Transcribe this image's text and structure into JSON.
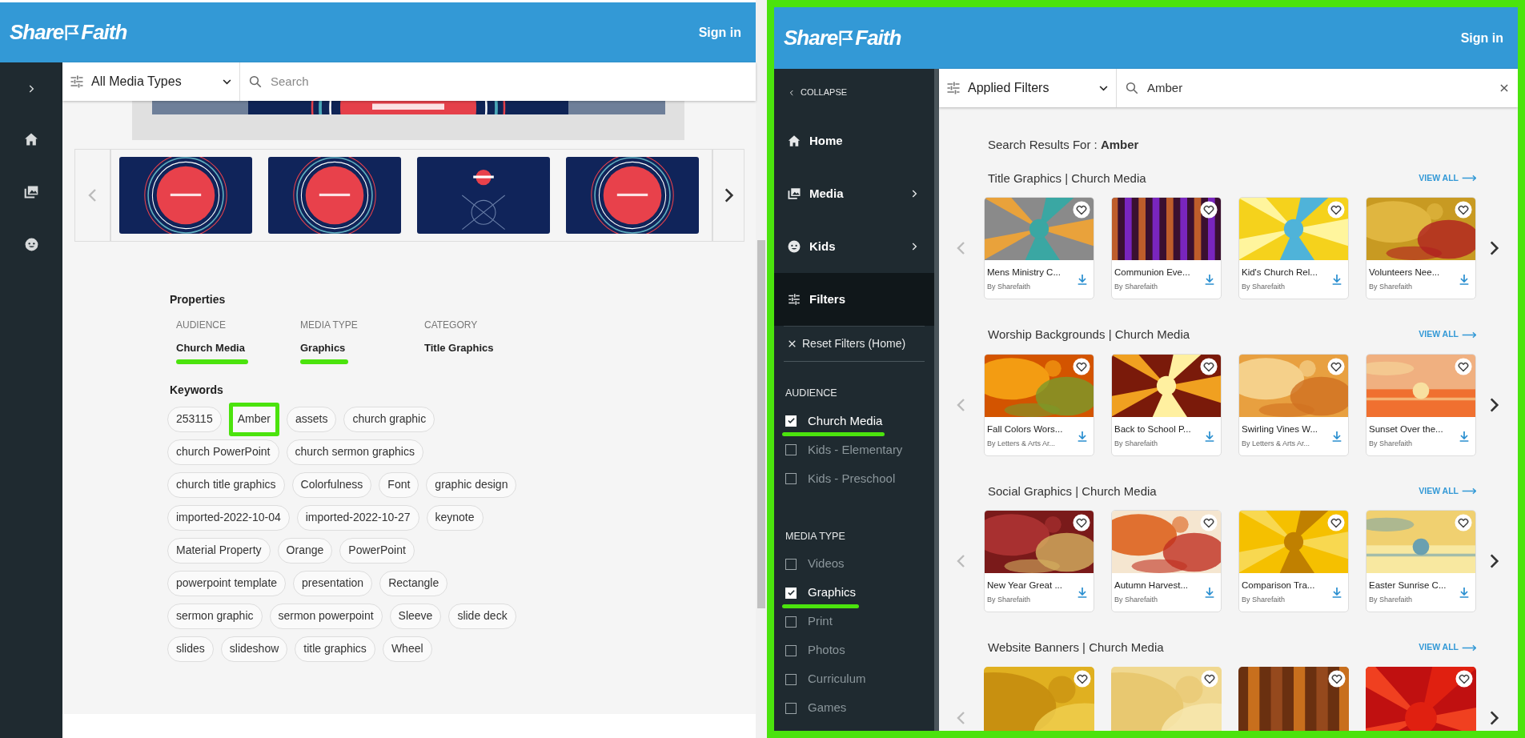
{
  "left_screen": {
    "header": {
      "logo": [
        "Share",
        "Faith"
      ],
      "sign_in": "Sign in"
    },
    "toolbar": {
      "filter": "All Media Types",
      "search": {
        "placeholder": "Search"
      }
    },
    "properties": {
      "title": "Properties",
      "items": [
        {
          "label": "AUDIENCE",
          "value": "Church Media",
          "highlighted": true
        },
        {
          "label": "MEDIA TYPE",
          "value": "Graphics",
          "highlighted": true
        },
        {
          "label": "CATEGORY",
          "value": "Title Graphics",
          "highlighted": false
        }
      ]
    },
    "keywords": {
      "title": "Keywords",
      "tags": [
        {
          "label": "253115",
          "highlighted": false
        },
        {
          "label": "Amber",
          "highlighted": true
        },
        {
          "label": "assets",
          "highlighted": false
        },
        {
          "label": "church graphic",
          "highlighted": false
        },
        {
          "label": "church PowerPoint",
          "highlighted": false
        },
        {
          "label": "church sermon graphics",
          "highlighted": false
        },
        {
          "label": "church title graphics",
          "highlighted": false
        },
        {
          "label": "Colorfulness",
          "highlighted": false
        },
        {
          "label": "Font",
          "highlighted": false
        },
        {
          "label": "graphic design",
          "highlighted": false
        },
        {
          "label": "imported-2022-10-04",
          "highlighted": false
        },
        {
          "label": "imported-2022-10-27",
          "highlighted": false
        },
        {
          "label": "keynote",
          "highlighted": false
        },
        {
          "label": "Material Property",
          "highlighted": false
        },
        {
          "label": "Orange",
          "highlighted": false
        },
        {
          "label": "PowerPoint",
          "highlighted": false
        },
        {
          "label": "powerpoint template",
          "highlighted": false
        },
        {
          "label": "presentation",
          "highlighted": false
        },
        {
          "label": "Rectangle",
          "highlighted": false
        },
        {
          "label": "sermon graphic",
          "highlighted": false
        },
        {
          "label": "sermon powerpoint",
          "highlighted": false
        },
        {
          "label": "Sleeve",
          "highlighted": false
        },
        {
          "label": "slide deck",
          "highlighted": false
        },
        {
          "label": "slides",
          "highlighted": false
        },
        {
          "label": "slideshow",
          "highlighted": false
        },
        {
          "label": "title graphics",
          "highlighted": false
        },
        {
          "label": "Wheel",
          "highlighted": false
        }
      ]
    }
  },
  "right_screen": {
    "header": {
      "logo": [
        "Share",
        "Faith"
      ],
      "sign_in": "Sign in"
    },
    "sidebar": {
      "collapse": "COLLAPSE",
      "items": [
        {
          "label": "Home",
          "submenu": false,
          "selected": false
        },
        {
          "label": "Media",
          "submenu": true,
          "selected": false
        },
        {
          "label": "Kids",
          "submenu": true,
          "selected": false
        },
        {
          "label": "Filters",
          "submenu": false,
          "selected": true
        }
      ],
      "reset": "Reset Filters (Home)",
      "groups": [
        {
          "title": "AUDIENCE",
          "options": [
            {
              "label": "Church Media",
              "checked": true,
              "highlighted": true
            },
            {
              "label": "Kids - Elementary",
              "checked": false,
              "highlighted": false
            },
            {
              "label": "Kids - Preschool",
              "checked": false,
              "highlighted": false
            }
          ]
        },
        {
          "title": "MEDIA TYPE",
          "options": [
            {
              "label": "Videos",
              "checked": false,
              "highlighted": false
            },
            {
              "label": "Graphics",
              "checked": true,
              "highlighted": true
            },
            {
              "label": "Print",
              "checked": false,
              "highlighted": false
            },
            {
              "label": "Photos",
              "checked": false,
              "highlighted": false
            },
            {
              "label": "Curriculum",
              "checked": false,
              "highlighted": false
            },
            {
              "label": "Games",
              "checked": false,
              "highlighted": false
            }
          ]
        }
      ]
    },
    "toolbar": {
      "filter": "Applied Filters",
      "search": {
        "value": "Amber"
      }
    },
    "results": {
      "heading": "Search Results For : **Amber**",
      "sections": [
        {
          "title": "Title Graphics | Church Media",
          "view_all": "VIEW ALL",
          "cards": [
            {
              "title": "Mens Ministry C...",
              "author": "By Sharefaith"
            },
            {
              "title": "Communion Eve...",
              "author": "By Sharefaith"
            },
            {
              "title": "Kid's Church Rel...",
              "author": "By Sharefaith"
            },
            {
              "title": "Volunteers Nee...",
              "author": "By Sharefaith"
            }
          ]
        },
        {
          "title": "Worship Backgrounds | Church Media",
          "view_all": "VIEW ALL",
          "cards": [
            {
              "title": "Fall Colors Wors...",
              "author": "By Letters & Arts Ar..."
            },
            {
              "title": "Back to School P...",
              "author": "By Sharefaith"
            },
            {
              "title": "Swirling Vines W...",
              "author": "By Letters & Arts Ar..."
            },
            {
              "title": "Sunset Over the...",
              "author": "By Sharefaith"
            }
          ]
        },
        {
          "title": "Social Graphics | Church Media",
          "view_all": "VIEW ALL",
          "cards": [
            {
              "title": "New Year Great ...",
              "author": "By Sharefaith"
            },
            {
              "title": "Autumn Harvest...",
              "author": "By Sharefaith"
            },
            {
              "title": "Comparison Tra...",
              "author": "By Sharefaith"
            },
            {
              "title": "Easter Sunrise C...",
              "author": "By Sharefaith"
            }
          ]
        },
        {
          "title": "Website Banners | Church Media",
          "view_all": "VIEW ALL"
        }
      ]
    }
  }
}
